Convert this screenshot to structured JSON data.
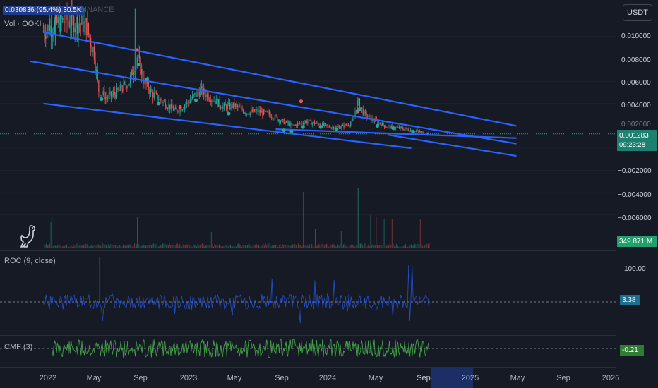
{
  "header": {
    "symbol_title": "OOKI / TetherUS, 1D, BINANCE",
    "price_box": "0.030836 (95.4%) 30.5K",
    "volume_label": "Vol · OOKI",
    "currency_button": "USDT"
  },
  "price_axis": {
    "ticks": [
      "0.010000",
      "0.008000",
      "0.006000",
      "0.004000",
      "0.002000",
      "−0.002000",
      "−0.004000",
      "−0.006000"
    ],
    "last_price": "0.001283",
    "countdown": "09:23:28",
    "volume_value": "349.871 M"
  },
  "roc_pane": {
    "label": "ROC (9, close)",
    "tick": "100.00",
    "value": "3.38"
  },
  "cmf_pane": {
    "label": "CMF (3)",
    "value": "-0.21"
  },
  "time_axis": {
    "labels": [
      "2022",
      "May",
      "Sep",
      "2023",
      "May",
      "Sep",
      "2024",
      "May",
      "Sep",
      "2025",
      "May",
      "Sep",
      "2026"
    ],
    "highlight_label": "Sep"
  },
  "colors": {
    "background": "#161a25",
    "up": "#26a69a",
    "down": "#ef5350",
    "trendline": "#2962ff",
    "roc": "#2962ff",
    "cmf": "#43a047",
    "last_price_tag": "#1e8071"
  },
  "icons": {
    "logo": "dino-logo-icon"
  },
  "chart_data": {
    "type": "candlestick",
    "x_range": [
      "2021-12",
      "2026-02"
    ],
    "y_range": [
      -0.0072,
      0.0115
    ],
    "price_series": {
      "dates": [
        "2021-12-20",
        "2022-01-15",
        "2022-02-15",
        "2022-03-15",
        "2022-04-10",
        "2022-05-01",
        "2022-05-12",
        "2022-06-01",
        "2022-07-01",
        "2022-08-01",
        "2022-08-20",
        "2022-09-10",
        "2022-10-01",
        "2022-11-01",
        "2022-12-01",
        "2023-01-01",
        "2023-02-01",
        "2023-03-01",
        "2023-04-01",
        "2023-05-01",
        "2023-06-01",
        "2023-07-01",
        "2023-08-01",
        "2023-09-01",
        "2023-10-01",
        "2023-11-01",
        "2023-12-01",
        "2024-01-01",
        "2024-02-01",
        "2024-03-01",
        "2024-03-15",
        "2024-04-01",
        "2024-05-01",
        "2024-06-01",
        "2024-07-01",
        "2024-08-01",
        "2024-09-01",
        "2024-09-15"
      ],
      "close": [
        0.0105,
        0.011,
        0.0115,
        0.0113,
        0.011,
        0.0085,
        0.0052,
        0.0045,
        0.005,
        0.006,
        0.0082,
        0.0058,
        0.0048,
        0.004,
        0.0033,
        0.0042,
        0.0052,
        0.0045,
        0.0037,
        0.0038,
        0.0032,
        0.0033,
        0.003,
        0.0024,
        0.002,
        0.0024,
        0.0022,
        0.0019,
        0.0019,
        0.0023,
        0.0042,
        0.003,
        0.0024,
        0.0019,
        0.0018,
        0.0016,
        0.0014,
        0.0013
      ]
    },
    "trendlines": [
      {
        "name": "upper channel",
        "points": [
          [
            "2021-12-20",
            0.0104
          ],
          [
            "2025-05-01",
            0.002
          ]
        ]
      },
      {
        "name": "middle channel",
        "points": [
          [
            "2021-11-15",
            0.0078
          ],
          [
            "2025-05-01",
            0.0004
          ]
        ]
      },
      {
        "name": "lower channel",
        "points": [
          [
            "2021-12-20",
            0.004
          ],
          [
            "2024-08-01",
            0.0
          ]
        ]
      },
      {
        "name": "support",
        "points": [
          [
            "2023-08-15",
            0.0017
          ],
          [
            "2025-05-01",
            0.0009
          ]
        ]
      },
      {
        "name": "lower line 2",
        "points": [
          [
            "2024-06-01",
            0.0012
          ],
          [
            "2025-05-01",
            -0.0007
          ]
        ]
      }
    ],
    "sell_markers": [
      [
        "2022-08-20",
        0.0088
      ],
      [
        "2022-12-10",
        0.0037
      ],
      [
        "2023-10-20",
        0.0042
      ],
      [
        "2024-03-15",
        0.0033
      ]
    ],
    "buy_markers": [
      [
        "2022-05-20",
        0.0044
      ],
      [
        "2022-08-25",
        0.0075
      ],
      [
        "2022-09-15",
        0.0062
      ],
      [
        "2022-10-15",
        0.004
      ],
      [
        "2023-01-20",
        0.0043
      ],
      [
        "2023-04-15",
        0.0031
      ],
      [
        "2023-09-05",
        0.0016
      ],
      [
        "2023-09-25",
        0.0015
      ],
      [
        "2023-10-25",
        0.0019
      ],
      [
        "2023-12-10",
        0.0019
      ],
      [
        "2024-01-20",
        0.0017
      ],
      [
        "2024-03-20",
        0.0035
      ],
      [
        "2024-05-05",
        0.002
      ],
      [
        "2024-06-15",
        0.0018
      ],
      [
        "2024-08-05",
        0.0015
      ]
    ],
    "last_price": 0.001283,
    "volume_last": "349.871 M",
    "roc_last": 3.38,
    "cmf_last": -0.21
  }
}
